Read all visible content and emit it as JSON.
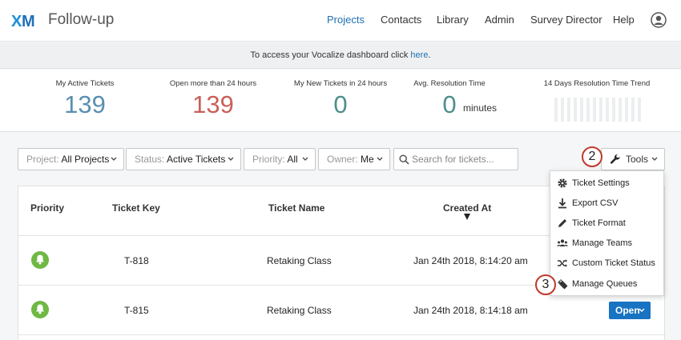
{
  "app": {
    "title": "Follow-up"
  },
  "nav": {
    "items": [
      "Projects",
      "Contacts",
      "Library",
      "Admin",
      "Survey Director",
      "Help"
    ],
    "active": "Projects"
  },
  "banner": {
    "text": "To access your Vocalize dashboard click",
    "link": "here",
    "period": "."
  },
  "stats": {
    "my_active": {
      "label": "My Active Tickets",
      "value": "139"
    },
    "open_24": {
      "label": "Open more than 24 hours",
      "value": "139"
    },
    "new_24": {
      "label": "My New Tickets in 24 hours",
      "value": "0"
    },
    "avg_resolution": {
      "label": "Avg. Resolution Time",
      "value": "0",
      "unit": "minutes"
    },
    "trend": {
      "label": "14 Days Resolution Time Trend"
    }
  },
  "filters": {
    "project": {
      "key": "Project:",
      "value": "All Projects"
    },
    "status": {
      "key": "Status:",
      "value": "Active Tickets"
    },
    "priority": {
      "key": "Priority:",
      "value": "All"
    },
    "owner": {
      "key": "Owner:",
      "value": "Me"
    },
    "search_placeholder": "Search for tickets..."
  },
  "tools": {
    "label": "Tools",
    "menu": [
      {
        "label": "Ticket Settings",
        "icon": "gear-icon"
      },
      {
        "label": "Export CSV",
        "icon": "download-icon"
      },
      {
        "label": "Ticket Format",
        "icon": "pencil-icon"
      },
      {
        "label": "Manage Teams",
        "icon": "teams-icon"
      },
      {
        "label": "Custom Ticket Status",
        "icon": "shuffle-icon"
      },
      {
        "label": "Manage Queues",
        "icon": "tags-icon"
      }
    ]
  },
  "table": {
    "columns": [
      "Priority",
      "Ticket Key",
      "Ticket Name",
      "Created At"
    ],
    "rows": [
      {
        "key": "T-818",
        "name": "Retaking Class",
        "created": "Jan 24th 2018, 8:14:20 am",
        "status": ""
      },
      {
        "key": "T-815",
        "name": "Retaking Class",
        "created": "Jan 24th 2018, 8:14:18 am",
        "status": "Open"
      }
    ]
  },
  "steps": [
    "2",
    "3"
  ],
  "colors": {
    "accent": "#1f6fb2",
    "button_blue": "#1873c2",
    "priority_green": "#6fb844",
    "step_red": "#c0392b",
    "stat_blue": "#5a8fb0",
    "stat_red": "#c9605a",
    "stat_teal": "#4d8e8a"
  }
}
